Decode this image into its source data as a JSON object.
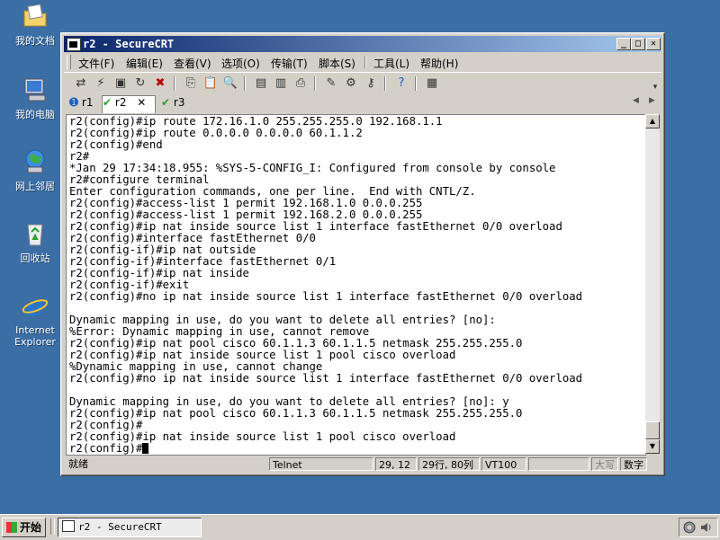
{
  "desktop": {
    "icons": [
      {
        "label": "我的文档",
        "icon": "my-documents-icon"
      },
      {
        "label": "我的电脑",
        "icon": "my-computer-icon"
      },
      {
        "label": "网上邻居",
        "icon": "network-places-icon"
      },
      {
        "label": "回收站",
        "icon": "recycle-bin-icon"
      },
      {
        "label": "Internet Explorer",
        "icon": "internet-explorer-icon"
      }
    ]
  },
  "window": {
    "title": "r2 - SecureCRT",
    "controls": {
      "minimize": "_",
      "maximize": "□",
      "close": "✕"
    }
  },
  "menu": {
    "items": [
      "文件(F)",
      "编辑(E)",
      "查看(V)",
      "选项(O)",
      "传输(T)",
      "脚本(S)",
      "工具(L)",
      "帮助(H)"
    ]
  },
  "tabs": [
    {
      "label": "r1",
      "state": "info"
    },
    {
      "label": "r2",
      "state": "connected",
      "active": true,
      "close": "✕"
    },
    {
      "label": "r3",
      "state": "connected"
    }
  ],
  "terminal": {
    "lines": [
      "r2(config)#ip route 172.16.1.0 255.255.255.0 192.168.1.1",
      "r2(config)#ip route 0.0.0.0 0.0.0.0 60.1.1.2",
      "r2(config)#end",
      "r2#",
      "*Jan 29 17:34:18.955: %SYS-5-CONFIG_I: Configured from console by console",
      "r2#configure terminal",
      "Enter configuration commands, one per line.  End with CNTL/Z.",
      "r2(config)#access-list 1 permit 192.168.1.0 0.0.0.255",
      "r2(config)#access-list 1 permit 192.168.2.0 0.0.0.255",
      "r2(config)#ip nat inside source list 1 interface fastEthernet 0/0 overload",
      "r2(config)#interface fastEthernet 0/0",
      "r2(config-if)#ip nat outside",
      "r2(config-if)#interface fastEthernet 0/1",
      "r2(config-if)#ip nat inside",
      "r2(config-if)#exit",
      "r2(config)#no ip nat inside source list 1 interface fastEthernet 0/0 overload",
      "",
      "Dynamic mapping in use, do you want to delete all entries? [no]:",
      "%Error: Dynamic mapping in use, cannot remove",
      "r2(config)#ip nat pool cisco 60.1.1.3 60.1.1.5 netmask 255.255.255.0",
      "r2(config)#ip nat inside source list 1 pool cisco overload",
      "%Dynamic mapping in use, cannot change",
      "r2(config)#no ip nat inside source list 1 interface fastEthernet 0/0 overload",
      "",
      "Dynamic mapping in use, do you want to delete all entries? [no]: y",
      "r2(config)#ip nat pool cisco 60.1.1.3 60.1.1.5 netmask 255.255.255.0",
      "r2(config)#",
      "r2(config)#ip nat inside source list 1 pool cisco overload"
    ],
    "prompt": "r2(config)#"
  },
  "statusbar": {
    "ready": "就绪",
    "protocol": "Telnet",
    "cursor_pos": "29, 12",
    "size": "29行, 80列",
    "emulation": "VT100",
    "caps": "大写",
    "num": "数字"
  },
  "taskbar": {
    "start": "开始",
    "task": "r2 - SecureCRT"
  },
  "colors": {
    "desktop": "#3a6ea5",
    "titlebar_start": "#0a246a",
    "titlebar_end": "#a6caf0",
    "chrome": "#d4d0c8"
  }
}
